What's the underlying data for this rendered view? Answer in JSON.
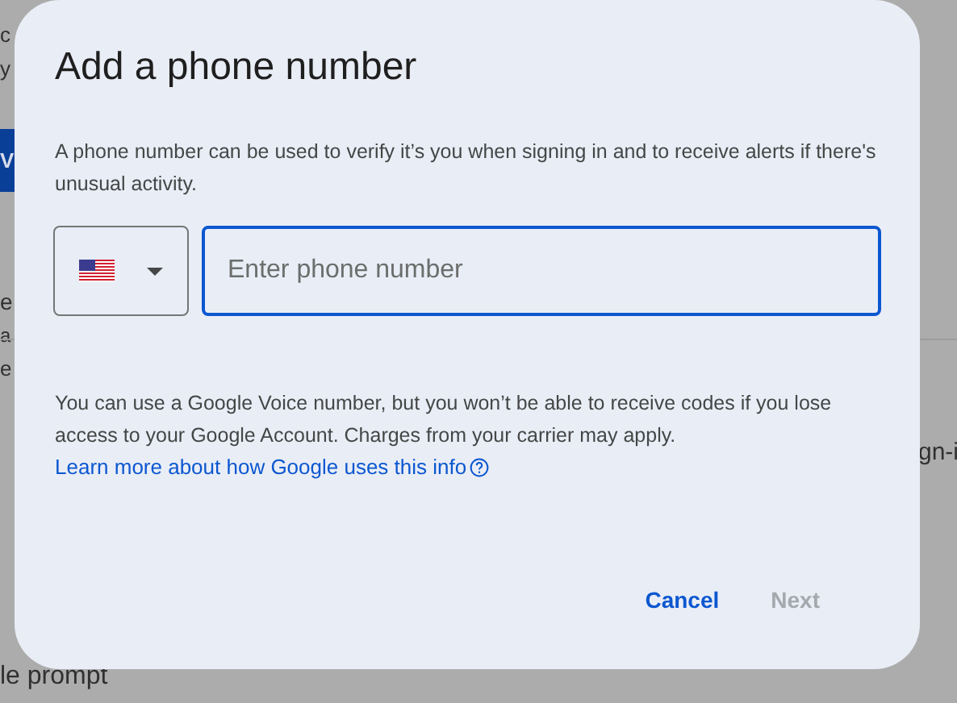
{
  "background_page": {
    "left_fragments": [
      {
        "kind": "text",
        "text": "c"
      },
      {
        "kind": "text",
        "text": "y"
      },
      {
        "kind": "button",
        "text": "V"
      },
      {
        "kind": "heading",
        "text": "e"
      },
      {
        "kind": "small",
        "text": "a"
      },
      {
        "kind": "text",
        "text": "e"
      }
    ],
    "bottom_text": "le prompt",
    "right_fragment": "gn-i"
  },
  "dialog": {
    "title": "Add a phone number",
    "description": "A phone number can be used to verify it’s you when signing in and to receive alerts if there's unusual activity.",
    "phone_field": {
      "placeholder": "Enter phone number",
      "focused": true
    },
    "note": "You can use a Google Voice number, but you won’t be able to receive codes if you lose access to your Google Account. Charges from your carrier may apply.",
    "link": "Learn more about how Google uses this info",
    "buttons": [
      {
        "label": "Cancel",
        "disabled": false
      },
      {
        "label": "Next",
        "disabled": true
      }
    ]
  }
}
